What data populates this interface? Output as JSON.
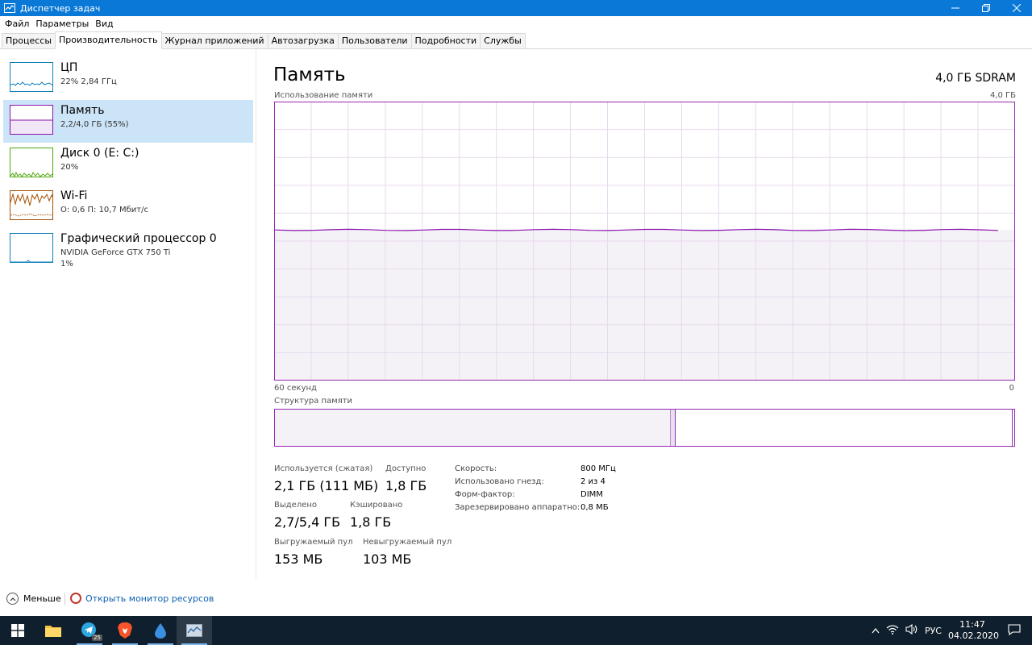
{
  "window": {
    "title": "Диспетчер задач"
  },
  "menu": [
    "Файл",
    "Параметры",
    "Вид"
  ],
  "tabs": [
    {
      "label": "Процессы",
      "active": false
    },
    {
      "label": "Производительность",
      "active": true
    },
    {
      "label": "Журнал приложений",
      "active": false
    },
    {
      "label": "Автозагрузка",
      "active": false
    },
    {
      "label": "Пользователи",
      "active": false
    },
    {
      "label": "Подробности",
      "active": false
    },
    {
      "label": "Службы",
      "active": false
    }
  ],
  "resources": [
    {
      "name": "ЦП",
      "sub": "22% 2,84 ГГц",
      "sub2": "",
      "color": "#117dbb",
      "selected": false
    },
    {
      "name": "Память",
      "sub": "2,2/4,0 ГБ (55%)",
      "sub2": "",
      "color": "#8b12ae",
      "selected": true
    },
    {
      "name": "Диск 0 (E: C:)",
      "sub": "20%",
      "sub2": "",
      "color": "#4da60c",
      "selected": false
    },
    {
      "name": "Wi-Fi",
      "sub": "О: 0,6 П: 10,7 Мбит/с",
      "sub2": "",
      "color": "#a74f01",
      "selected": false
    },
    {
      "name": "Графический процессор 0",
      "sub": "NVIDIA GeForce GTX 750 Ti",
      "sub2": "1%",
      "color": "#117dbb",
      "selected": false
    }
  ],
  "memory": {
    "title": "Память",
    "spec": "4,0 ГБ SDRAM",
    "graph_label": "Использование памяти",
    "graph_max": "4,0 ГБ",
    "graph_seconds": "60 секунд",
    "graph_zero": "0",
    "usage_fraction": 0.54,
    "structure_label": "Структура памяти",
    "structure_in_use_fraction": 0.535,
    "structure_modified_fraction": 0.006,
    "stats": {
      "in_use_label": "Используется (сжатая)",
      "in_use_value": "2,1 ГБ (111 МБ)",
      "available_label": "Доступно",
      "available_value": "1,8 ГБ",
      "committed_label": "Выделено",
      "committed_value": "2,7/5,4 ГБ",
      "cached_label": "Кэшировано",
      "cached_value": "1,8 ГБ",
      "paged_label": "Выгружаемый пул",
      "paged_value": "153 МБ",
      "nonpaged_label": "Невыгружаемый пул",
      "nonpaged_value": "103 МБ"
    },
    "details": [
      {
        "label": "Скорость:",
        "value": "800 МГц"
      },
      {
        "label": "Использовано гнезд:",
        "value": "2 из 4"
      },
      {
        "label": "Форм-фактор:",
        "value": "DIMM"
      },
      {
        "label": "Зарезервировано аппаратно:",
        "value": "0,8 МБ"
      }
    ]
  },
  "footer": {
    "fewer": "Меньше",
    "monitor": "Открыть монитор ресурсов"
  },
  "taskbar": {
    "language": "РУС",
    "time": "11:47",
    "date": "04.02.2020",
    "telegram_badge": "25"
  }
}
